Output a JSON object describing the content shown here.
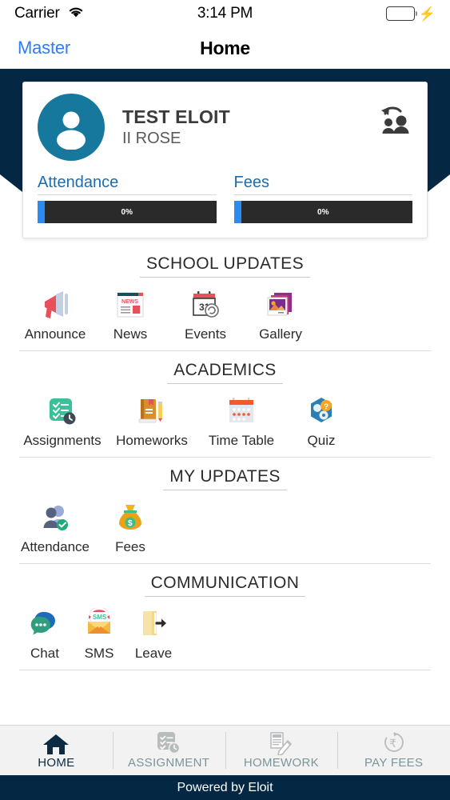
{
  "status_bar": {
    "carrier": "Carrier",
    "time": "3:14 PM",
    "wifi_icon": "wifi-icon",
    "battery_icon": "battery-icon",
    "charging_icon": "lightning-bolt-icon",
    "battery_color": "#4cd964"
  },
  "nav_bar": {
    "back_label": "Master",
    "title": "Home",
    "back_color": "#2f7cf6"
  },
  "theme": {
    "navy": "#042743",
    "avatar_teal": "#16789d",
    "link_blue": "#1d6cad",
    "progress_blue": "#2b8bf0",
    "progress_track": "#2a2a2a",
    "tab_inactive": "#7d9499"
  },
  "profile": {
    "avatar_icon": "person-avatar-icon",
    "name": "TEST ELOIT",
    "class": "II ROSE",
    "switch_user_icon": "switch-user-icon",
    "meters": [
      {
        "label": "Attendance",
        "value": "0%",
        "percent": 0
      },
      {
        "label": "Fees",
        "value": "0%",
        "percent": 0
      }
    ]
  },
  "sections": [
    {
      "title": "SCHOOL UPDATES",
      "items": [
        {
          "label": "Announce",
          "icon": "megaphone-icon"
        },
        {
          "label": "News",
          "icon": "newspaper-icon"
        },
        {
          "label": "Events",
          "icon": "calendar-events-icon"
        },
        {
          "label": "Gallery",
          "icon": "photo-gallery-icon"
        }
      ]
    },
    {
      "title": "ACADEMICS",
      "items": [
        {
          "label": "Assignments",
          "icon": "checklist-clock-icon"
        },
        {
          "label": "Homeworks",
          "icon": "book-pencil-icon"
        },
        {
          "label": "Time Table",
          "icon": "calendar-grid-icon"
        },
        {
          "label": "Quiz",
          "icon": "quiz-hexagon-icon"
        }
      ]
    },
    {
      "title": "MY UPDATES",
      "items": [
        {
          "label": "Attendance",
          "icon": "people-check-icon"
        },
        {
          "label": "Fees",
          "icon": "money-bag-icon"
        }
      ]
    },
    {
      "title": "COMMUNICATION",
      "items": [
        {
          "label": "Chat",
          "icon": "chat-bubbles-icon"
        },
        {
          "label": "SMS",
          "icon": "sms-envelope-icon"
        },
        {
          "label": "Leave",
          "icon": "exit-door-icon"
        }
      ]
    }
  ],
  "tab_bar": {
    "tabs": [
      {
        "label": "HOME",
        "icon": "home-icon",
        "active": true
      },
      {
        "label": "ASSIGNMENT",
        "icon": "checklist-clock-icon",
        "active": false
      },
      {
        "label": "HOMEWORK",
        "icon": "notebook-pencil-icon",
        "active": false
      },
      {
        "label": "PAY FEES",
        "icon": "rupee-refresh-icon",
        "active": false
      }
    ]
  },
  "footer": {
    "text": "Powered by Eloit"
  }
}
